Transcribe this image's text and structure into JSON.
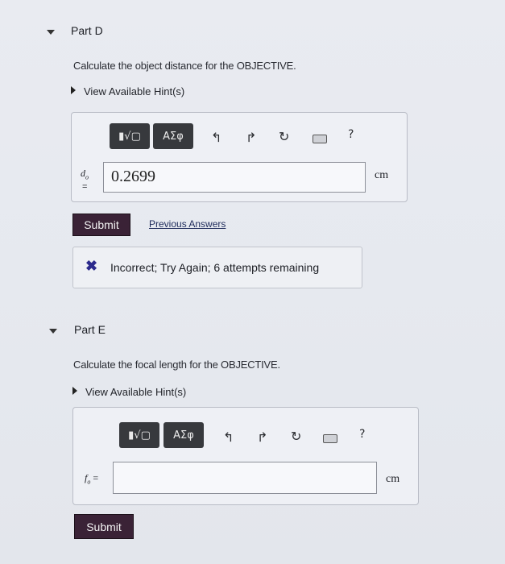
{
  "partD": {
    "title": "Part D",
    "prompt": "Calculate the object distance for the OBJECTIVE.",
    "hints": "View Available Hint(s)",
    "toolbar": {
      "templates_label": "▮√▢",
      "greek_label": "ΑΣφ",
      "help": "?"
    },
    "var_label": "d",
    "var_sub": "o",
    "equals": "=",
    "input_value": "0.2699",
    "unit": "cm",
    "submit": "Submit",
    "previous_answers": "Previous Answers",
    "feedback": "Incorrect; Try Again; 6 attempts remaining"
  },
  "partE": {
    "title": "Part E",
    "prompt": "Calculate the focal length for the OBJECTIVE.",
    "hints": "View Available Hint(s)",
    "toolbar": {
      "templates_label": "▮√▢",
      "greek_label": "ΑΣφ",
      "help": "?"
    },
    "var_label": "f",
    "var_sub": "o",
    "equals": "=",
    "input_value": "",
    "unit": "cm",
    "submit": "Submit"
  },
  "colors": {
    "submit_bg": "#3a2236",
    "incorrect_x": "#2b2a8c",
    "toolbar_btn": "#37393d"
  },
  "icons": [
    "collapse-caret-icon",
    "expand-caret-icon",
    "undo-icon",
    "redo-icon",
    "reset-icon",
    "keyboard-icon",
    "help-icon",
    "incorrect-x-icon"
  ]
}
